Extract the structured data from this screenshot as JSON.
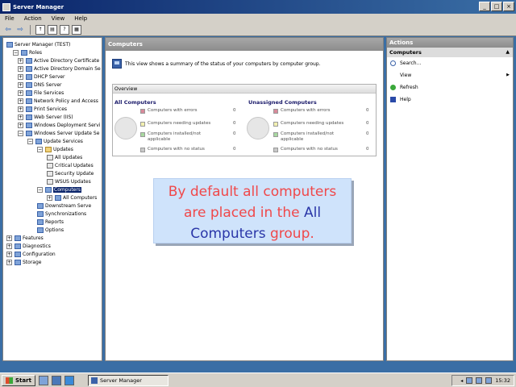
{
  "window": {
    "title": "Server Manager"
  },
  "menu": [
    "File",
    "Action",
    "View",
    "Help"
  ],
  "tree": [
    {
      "label": "Server Manager (TEST)",
      "level": 0,
      "exp": "",
      "icon": "server-icon"
    },
    {
      "label": "Roles",
      "level": 1,
      "exp": "−",
      "icon": "roles-icon"
    },
    {
      "label": "Active Directory Certificate",
      "level": 2,
      "exp": "+",
      "icon": "role-icon"
    },
    {
      "label": "Active Directory Domain Se",
      "level": 2,
      "exp": "+",
      "icon": "role-icon"
    },
    {
      "label": "DHCP Server",
      "level": 2,
      "exp": "+",
      "icon": "role-icon"
    },
    {
      "label": "DNS Server",
      "level": 2,
      "exp": "+",
      "icon": "role-icon"
    },
    {
      "label": "File Services",
      "level": 2,
      "exp": "+",
      "icon": "role-icon"
    },
    {
      "label": "Network Policy and Access",
      "level": 2,
      "exp": "+",
      "icon": "role-icon"
    },
    {
      "label": "Print Services",
      "level": 2,
      "exp": "+",
      "icon": "role-icon"
    },
    {
      "label": "Web Server (IIS)",
      "level": 2,
      "exp": "+",
      "icon": "role-icon"
    },
    {
      "label": "Windows Deployment Servi",
      "level": 2,
      "exp": "+",
      "icon": "role-icon"
    },
    {
      "label": "Windows Server Update Se",
      "level": 2,
      "exp": "−",
      "icon": "role-icon"
    },
    {
      "label": "Update Services",
      "level": 3,
      "exp": "−",
      "icon": "wsus-icon"
    },
    {
      "label": "Updates",
      "level": 4,
      "exp": "−",
      "icon": "folder-icon"
    },
    {
      "label": "All Updates",
      "level": 5,
      "exp": "",
      "icon": "doc-icon"
    },
    {
      "label": "Critical Updates",
      "level": 5,
      "exp": "",
      "icon": "doc-icon"
    },
    {
      "label": "Security Update",
      "level": 5,
      "exp": "",
      "icon": "doc-icon"
    },
    {
      "label": "WSUS Updates",
      "level": 5,
      "exp": "",
      "icon": "doc-icon"
    },
    {
      "label": "Computers",
      "level": 4,
      "exp": "−",
      "icon": "computers-icon",
      "selected": true
    },
    {
      "label": "All Computers",
      "level": 5,
      "exp": "+",
      "icon": "computers-icon"
    },
    {
      "label": "Downstream Serve",
      "level": 4,
      "exp": "",
      "icon": "server-icon"
    },
    {
      "label": "Synchronizations",
      "level": 4,
      "exp": "",
      "icon": "sync-icon"
    },
    {
      "label": "Reports",
      "level": 4,
      "exp": "",
      "icon": "reports-icon"
    },
    {
      "label": "Options",
      "level": 4,
      "exp": "",
      "icon": "options-icon"
    },
    {
      "label": "Features",
      "level": 0,
      "exp": "+",
      "icon": "features-icon"
    },
    {
      "label": "Diagnostics",
      "level": 0,
      "exp": "+",
      "icon": "diagnostics-icon"
    },
    {
      "label": "Configuration",
      "level": 0,
      "exp": "+",
      "icon": "configuration-icon"
    },
    {
      "label": "Storage",
      "level": 0,
      "exp": "+",
      "icon": "storage-icon"
    }
  ],
  "center": {
    "header": "Computers",
    "summary": "This view shows a summary of the status of your computers by computer group.",
    "overview_title": "Overview",
    "columns": [
      {
        "title": "All Computers",
        "stats": [
          {
            "label": "Computers with errors",
            "value": "0",
            "color": "#d88a9a"
          },
          {
            "label": "Computers needing updates",
            "value": "0",
            "color": "#f2f0b0"
          },
          {
            "label": "Computers installed/not applicable",
            "value": "0",
            "color": "#a8d8a0"
          },
          {
            "label": "Computers with no status",
            "value": "0",
            "color": "#c8c8c8"
          }
        ]
      },
      {
        "title": "Unassigned Computers",
        "stats": [
          {
            "label": "Computers with errors",
            "value": "0",
            "color": "#d88a9a"
          },
          {
            "label": "Computers needing updates",
            "value": "0",
            "color": "#f2f0b0"
          },
          {
            "label": "Computers installed/not applicable",
            "value": "0",
            "color": "#a8d8a0"
          },
          {
            "label": "Computers with no status",
            "value": "0",
            "color": "#c8c8c8"
          }
        ]
      }
    ]
  },
  "actions": {
    "header": "Actions",
    "sub": "Computers",
    "items": [
      {
        "label": "Search...",
        "icon": "search-icon",
        "submenu": false
      },
      {
        "label": "View",
        "icon": "",
        "submenu": true
      },
      {
        "label": "Refresh",
        "icon": "refresh-icon",
        "submenu": false
      },
      {
        "label": "Help",
        "icon": "help-icon",
        "submenu": false
      }
    ]
  },
  "callout": {
    "line1": "By default all computers",
    "line2a": "are placed in the",
    "line2b": "All",
    "line3a": "Computers",
    "line3b": "group."
  },
  "taskbar": {
    "start": "Start",
    "task": "Server Manager",
    "clock": "15:32"
  }
}
